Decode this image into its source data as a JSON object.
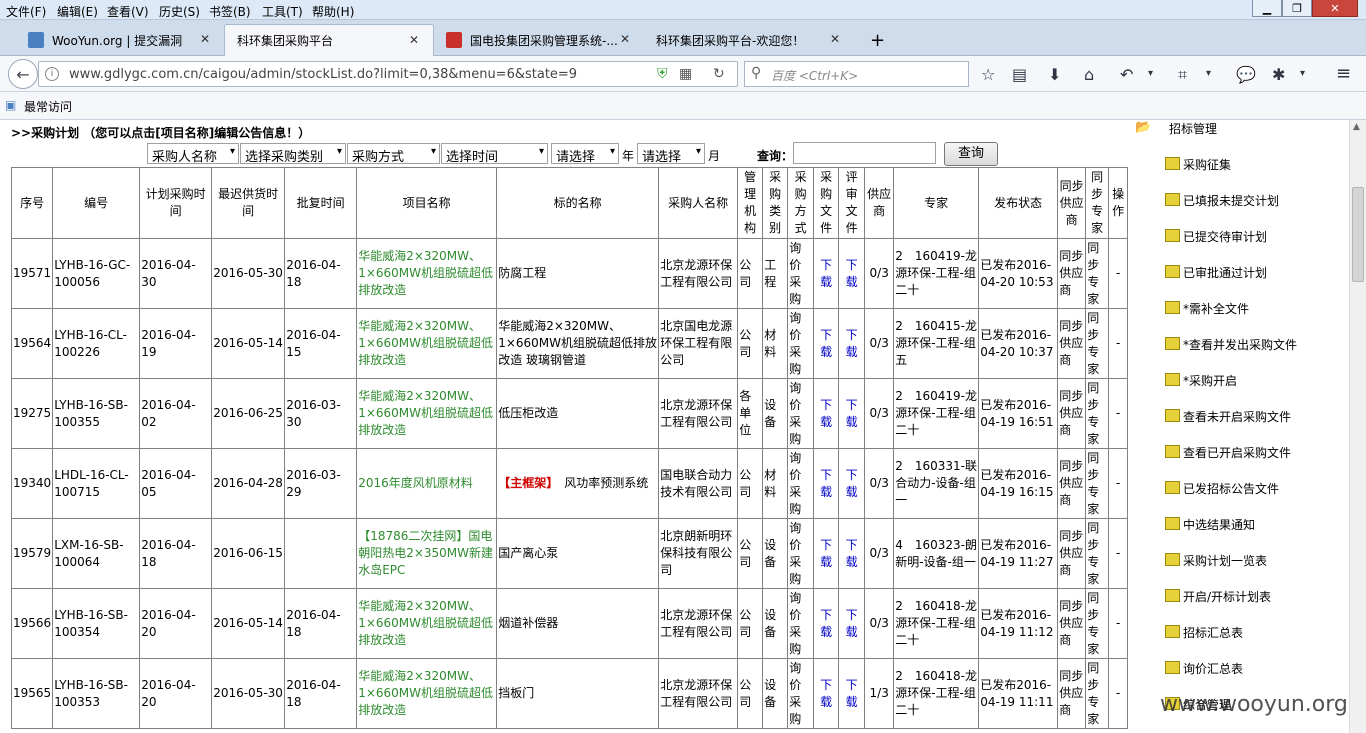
{
  "menubar": {
    "items": [
      "文件(F)",
      "编辑(E)",
      "查看(V)",
      "历史(S)",
      "书签(B)",
      "工具(T)",
      "帮助(H)"
    ]
  },
  "tabs": [
    {
      "label": "WooYun.org | 提交漏洞"
    },
    {
      "label": "科环集团采购平台"
    },
    {
      "label": "国电投集团采购管理系统-..."
    },
    {
      "label": "科环集团采购平台-欢迎您！"
    }
  ],
  "nav": {
    "url": "www.gdlygc.com.cn/caigou/admin/stockList.do?limit=0,38&menu=6&state=9",
    "search_placeholder": "百度 <Ctrl+K>"
  },
  "bookmarks": {
    "label": "最常访问"
  },
  "page": {
    "title": ">>采购计划 （您可以点击[项目名称]编辑公告信息！）",
    "filters": {
      "purchaser": "采购人名称",
      "category": "选择采购类别",
      "method": "采购方式",
      "time": "选择时间",
      "year_select": "请选择",
      "year_label": "年",
      "month_select": "请选择",
      "month_label": "月",
      "query_label": "查询：",
      "query_button": "查询"
    },
    "table": {
      "headers": [
        "序号",
        "编号",
        "计划采购时间",
        "最迟供货时间",
        "批复时间",
        "项目名称",
        "标的名称",
        "采购人名称",
        "管理机构",
        "采购类别",
        "采购方式",
        "采购文件",
        "评审文件",
        "供应商",
        "专家",
        "发布状态",
        "同步供应商",
        "同步专家",
        "操作"
      ],
      "rows": [
        {
          "seq": "19571",
          "code": "LYHB-16-GC-100056",
          "plan": "2016-04-30",
          "supply": "2016-05-30",
          "approve": "2016-04-18",
          "project": "华能威海2×320MW、1×660MW机组脱硫超低排放改造",
          "tag": "",
          "subject": "防腐工程",
          "buyer": "北京龙源环保工程有限公司",
          "org": "公司",
          "type": "工程",
          "method": "询价采购",
          "pdoc": "下载",
          "rdoc": "下载",
          "supplier": "0/3",
          "expert": "2　160419-龙源环保-工程-组二十",
          "status": "已发布2016-04-20 10:53",
          "ssup": "同步供应商",
          "sexp": "同步专家",
          "op": "-"
        },
        {
          "seq": "19564",
          "code": "LYHB-16-CL-100226",
          "plan": "2016-04-19",
          "supply": "2016-05-14",
          "approve": "2016-04-15",
          "project": "华能威海2×320MW、1×660MW机组脱硫超低排放改造",
          "tag": "",
          "subject": "华能威海2×320MW、1×660MW机组脱硫超低排放改造 玻璃钢管道",
          "buyer": "北京国电龙源环保工程有限公司",
          "org": "公司",
          "type": "材料",
          "method": "询价采购",
          "pdoc": "下载",
          "rdoc": "下载",
          "supplier": "0/3",
          "expert": "2　160415-龙源环保-工程-组五",
          "status": "已发布2016-04-20 10:37",
          "ssup": "同步供应商",
          "sexp": "同步专家",
          "op": "-"
        },
        {
          "seq": "19275",
          "code": "LYHB-16-SB-100355",
          "plan": "2016-04-02",
          "supply": "2016-06-25",
          "approve": "2016-03-30",
          "project": "华能威海2×320MW、1×660MW机组脱硫超低排放改造",
          "tag": "",
          "subject": "低压柜改造",
          "buyer": "北京龙源环保工程有限公司",
          "org": "各单位",
          "type": "设备",
          "method": "询价采购",
          "pdoc": "下载",
          "rdoc": "下载",
          "supplier": "0/3",
          "expert": "2　160419-龙源环保-工程-组二十",
          "status": "已发布2016-04-19 16:51",
          "ssup": "同步供应商",
          "sexp": "同步专家",
          "op": "-"
        },
        {
          "seq": "19340",
          "code": "LHDL-16-CL-100715",
          "plan": "2016-04-05",
          "supply": "2016-04-28",
          "approve": "2016-03-29",
          "project": "2016年度风机原材料",
          "tag": "【主框架】",
          "subject": "风功率预测系统",
          "buyer": "国电联合动力技术有限公司",
          "org": "公司",
          "type": "材料",
          "method": "询价采购",
          "pdoc": "下载",
          "rdoc": "下载",
          "supplier": "0/3",
          "expert": "2　160331-联合动力-设备-组一",
          "status": "已发布2016-04-19 16:15",
          "ssup": "同步供应商",
          "sexp": "同步专家",
          "op": "-"
        },
        {
          "seq": "19579",
          "code": "LXM-16-SB-100064",
          "plan": "2016-04-18",
          "supply": "2016-06-15",
          "approve": "",
          "project": "【18786二次挂网】国电朝阳热电2×350MW新建水岛EPC",
          "tag": "",
          "subject": "国产离心泵",
          "buyer": "北京朗新明环保科技有限公司",
          "org": "公司",
          "type": "设备",
          "method": "询价采购",
          "pdoc": "下载",
          "rdoc": "下载",
          "supplier": "0/3",
          "expert": "4　160323-朗新明-设备-组一",
          "status": "已发布2016-04-19 11:27",
          "ssup": "同步供应商",
          "sexp": "同步专家",
          "op": "-"
        },
        {
          "seq": "19566",
          "code": "LYHB-16-SB-100354",
          "plan": "2016-04-20",
          "supply": "2016-05-14",
          "approve": "2016-04-18",
          "project": "华能威海2×320MW、1×660MW机组脱硫超低排放改造",
          "tag": "",
          "subject": "烟道补偿器",
          "buyer": "北京龙源环保工程有限公司",
          "org": "公司",
          "type": "设备",
          "method": "询价采购",
          "pdoc": "下载",
          "rdoc": "下载",
          "supplier": "0/3",
          "expert": "2　160418-龙源环保-工程-组二十",
          "status": "已发布2016-04-19 11:12",
          "ssup": "同步供应商",
          "sexp": "同步专家",
          "op": "-"
        },
        {
          "seq": "19565",
          "code": "LYHB-16-SB-100353",
          "plan": "2016-04-20",
          "supply": "2016-05-30",
          "approve": "2016-04-18",
          "project": "华能威海2×320MW、1×660MW机组脱硫超低排放改造",
          "tag": "",
          "subject": "挡板门",
          "buyer": "北京龙源环保工程有限公司",
          "org": "公司",
          "type": "设备",
          "method": "询价采购",
          "pdoc": "下载",
          "rdoc": "下载",
          "supplier": "1/3",
          "expert": "2　160418-龙源环保-工程-组二十",
          "status": "已发布2016-04-19 11:11",
          "ssup": "同步供应商",
          "sexp": "同步专家",
          "op": "-"
        }
      ]
    }
  },
  "sidebar": {
    "header": "招标管理",
    "items": [
      "采购征集",
      "已填报未提交计划",
      "已提交待审计划",
      "已审批通过计划",
      "*需补全文件",
      "*查看并发出采购文件",
      "*采购开启",
      "查看未开启采购文件",
      "查看已开启采购文件",
      "已发招标公告文件",
      "中选结果通知",
      "采购计划一览表",
      "开启/开标计划表",
      "招标汇总表",
      "询价汇总表",
      "综合管理"
    ]
  },
  "watermark": "www.wooyun.org"
}
